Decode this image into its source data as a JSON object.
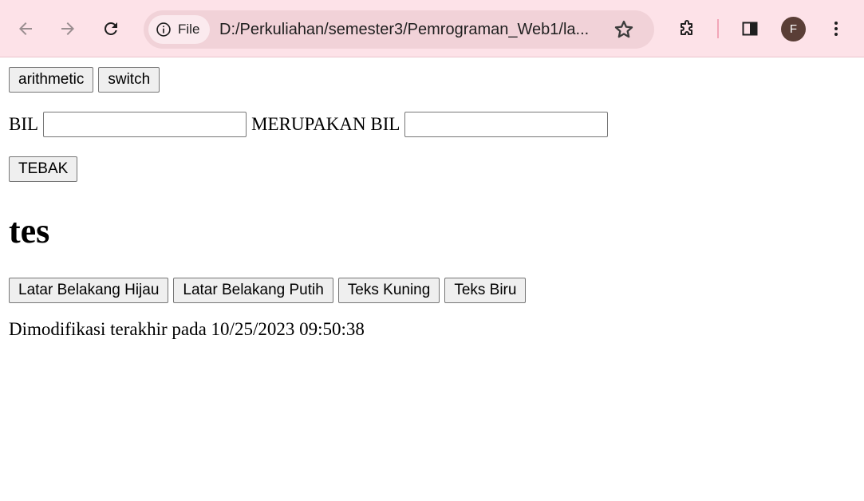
{
  "browser": {
    "chip_label": "File",
    "url": "D:/Perkuliahan/semester3/Pemrograman_Web1/la...",
    "avatar_letter": "F",
    "icons": [
      "back-icon",
      "forward-icon",
      "reload-icon",
      "info-icon",
      "star-icon",
      "extensions-icon",
      "side-panel-icon",
      "more-icon"
    ],
    "colors": {
      "toolbar_bg": "#fde2e8",
      "omnibox_bg": "#f1d2d8",
      "avatar_bg": "#5a3e36"
    }
  },
  "page": {
    "top_buttons": [
      "arithmetic",
      "switch"
    ],
    "form": {
      "label_bil": "BIL",
      "label_merupakan": "MERUPAKAN BIL",
      "input1_value": "",
      "input2_value": "",
      "submit_label": "TEBAK"
    },
    "heading": "tes",
    "style_buttons": [
      "Latar Belakang Hijau",
      "Latar Belakang Putih",
      "Teks Kuning",
      "Teks Biru"
    ],
    "last_modified": "Dimodifikasi terakhir pada 10/25/2023 09:50:38"
  }
}
